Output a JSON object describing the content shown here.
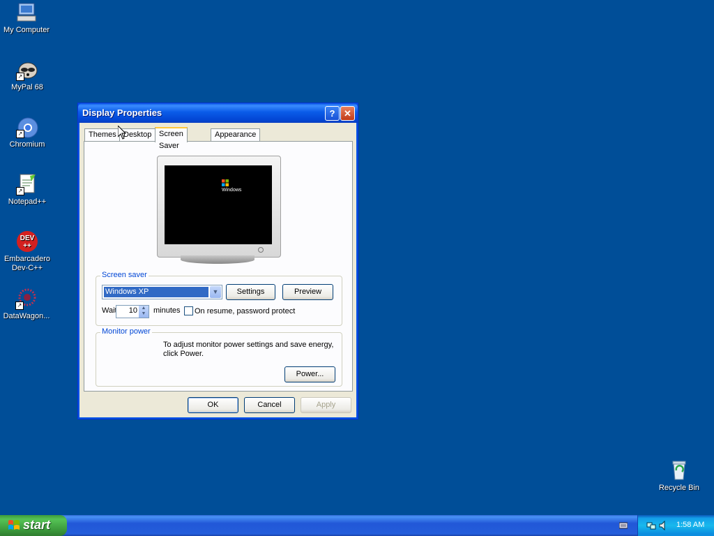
{
  "desktop": {
    "icons": [
      {
        "label": "My Computer"
      },
      {
        "label": "MyPal 68"
      },
      {
        "label": "Chromium"
      },
      {
        "label": "Notepad++"
      },
      {
        "label": "Embarcadero Dev-C++"
      },
      {
        "label": "DataWagon..."
      },
      {
        "label": "Recycle Bin"
      }
    ]
  },
  "dialog": {
    "title": "Display Properties",
    "help_glyph": "?",
    "close_glyph": "✕",
    "tabs": [
      {
        "label": "Themes"
      },
      {
        "label": "Desktop"
      },
      {
        "label": "Screen Saver",
        "active": true
      },
      {
        "label": "Appearance"
      }
    ],
    "preview_logo": "Windows",
    "screen_saver": {
      "group_label": "Screen saver",
      "selected": "Windows XP",
      "settings_label": "Settings",
      "preview_label": "Preview",
      "wait_label": "Wait:",
      "wait_value": "10",
      "minutes_label": "minutes",
      "password_label": "On resume, password protect",
      "password_checked": false
    },
    "monitor_power": {
      "group_label": "Monitor power",
      "description": "To adjust monitor power settings and save energy, click Power.",
      "power_label": "Power..."
    },
    "buttons": {
      "ok": "OK",
      "cancel": "Cancel",
      "apply": "Apply"
    }
  },
  "taskbar": {
    "start_label": "start",
    "clock": "1:58 AM"
  }
}
